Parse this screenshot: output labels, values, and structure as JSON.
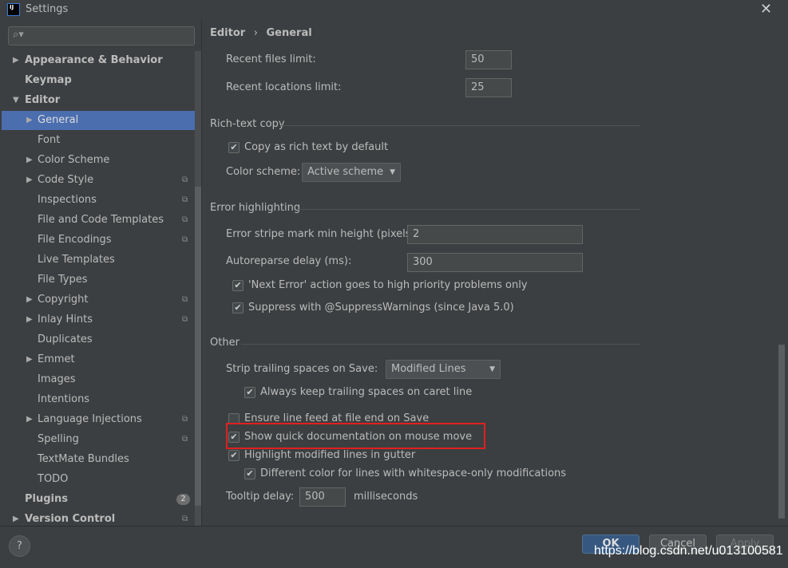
{
  "window": {
    "title": "Settings",
    "close": "✕",
    "logo": "IJ"
  },
  "search": {
    "placeholder": "",
    "icon": "search-icon"
  },
  "sidebar": {
    "items": [
      {
        "label": "Appearance & Behavior",
        "arrow": "▶",
        "level": 0,
        "bold": true
      },
      {
        "label": "Keymap",
        "level": 0,
        "bold": true
      },
      {
        "label": "Editor",
        "arrow": "▼",
        "level": 0,
        "bold": true
      },
      {
        "label": "General",
        "arrow": "▶",
        "level": 1,
        "selected": true
      },
      {
        "label": "Font",
        "level": 1
      },
      {
        "label": "Color Scheme",
        "arrow": "▶",
        "level": 1
      },
      {
        "label": "Code Style",
        "arrow": "▶",
        "level": 1,
        "copy": true
      },
      {
        "label": "Inspections",
        "level": 1,
        "copy": true
      },
      {
        "label": "File and Code Templates",
        "level": 1,
        "copy": true
      },
      {
        "label": "File Encodings",
        "level": 1,
        "copy": true
      },
      {
        "label": "Live Templates",
        "level": 1
      },
      {
        "label": "File Types",
        "level": 1
      },
      {
        "label": "Copyright",
        "arrow": "▶",
        "level": 1,
        "copy": true
      },
      {
        "label": "Inlay Hints",
        "arrow": "▶",
        "level": 1,
        "copy": true
      },
      {
        "label": "Duplicates",
        "level": 1
      },
      {
        "label": "Emmet",
        "arrow": "▶",
        "level": 1
      },
      {
        "label": "Images",
        "level": 1
      },
      {
        "label": "Intentions",
        "level": 1
      },
      {
        "label": "Language Injections",
        "arrow": "▶",
        "level": 1,
        "copy": true
      },
      {
        "label": "Spelling",
        "level": 1,
        "copy": true
      },
      {
        "label": "TextMate Bundles",
        "level": 1
      },
      {
        "label": "TODO",
        "level": 1
      },
      {
        "label": "Plugins",
        "level": 0,
        "bold": true,
        "badge": "2"
      },
      {
        "label": "Version Control",
        "arrow": "▶",
        "level": 0,
        "bold": true,
        "copy": true
      }
    ]
  },
  "breadcrumb": {
    "parent": "Editor",
    "sep": "›",
    "current": "General"
  },
  "settings": {
    "recent_files_label": "Recent files limit:",
    "recent_files": "50",
    "recent_locations_label": "Recent locations limit:",
    "recent_locations": "25",
    "rich_text_section": "Rich-text copy",
    "copy_rich": "Copy as rich text by default",
    "color_scheme_label": "Color scheme:",
    "color_scheme": "Active scheme",
    "error_section": "Error highlighting",
    "stripe_label": "Error stripe mark min height (pixels):",
    "stripe": "2",
    "autoreparse_label": "Autoreparse delay (ms):",
    "autoreparse": "300",
    "next_error": "'Next Error' action goes to high priority problems only",
    "suppress": "Suppress with @SuppressWarnings (since Java 5.0)",
    "other_section": "Other",
    "strip_label": "Strip trailing spaces on Save:",
    "strip": "Modified Lines",
    "keep_trailing": "Always keep trailing spaces on caret line",
    "line_feed": "Ensure line feed at file end on Save",
    "quick_doc": "Show quick documentation on mouse move",
    "highlight_modified": "Highlight modified lines in gutter",
    "diff_color": "Different color for lines with whitespace-only modifications",
    "tooltip_label": "Tooltip delay:",
    "tooltip": "500",
    "tooltip_unit": "milliseconds"
  },
  "footer": {
    "help": "?",
    "ok": "OK",
    "cancel": "Cancel",
    "apply": "Apply"
  },
  "watermark": "https://blog.csdn.net/u013100581",
  "colors": {
    "selection": "#4b6eaf",
    "highlight_box": "#e02020",
    "ok_button": "#365880"
  }
}
